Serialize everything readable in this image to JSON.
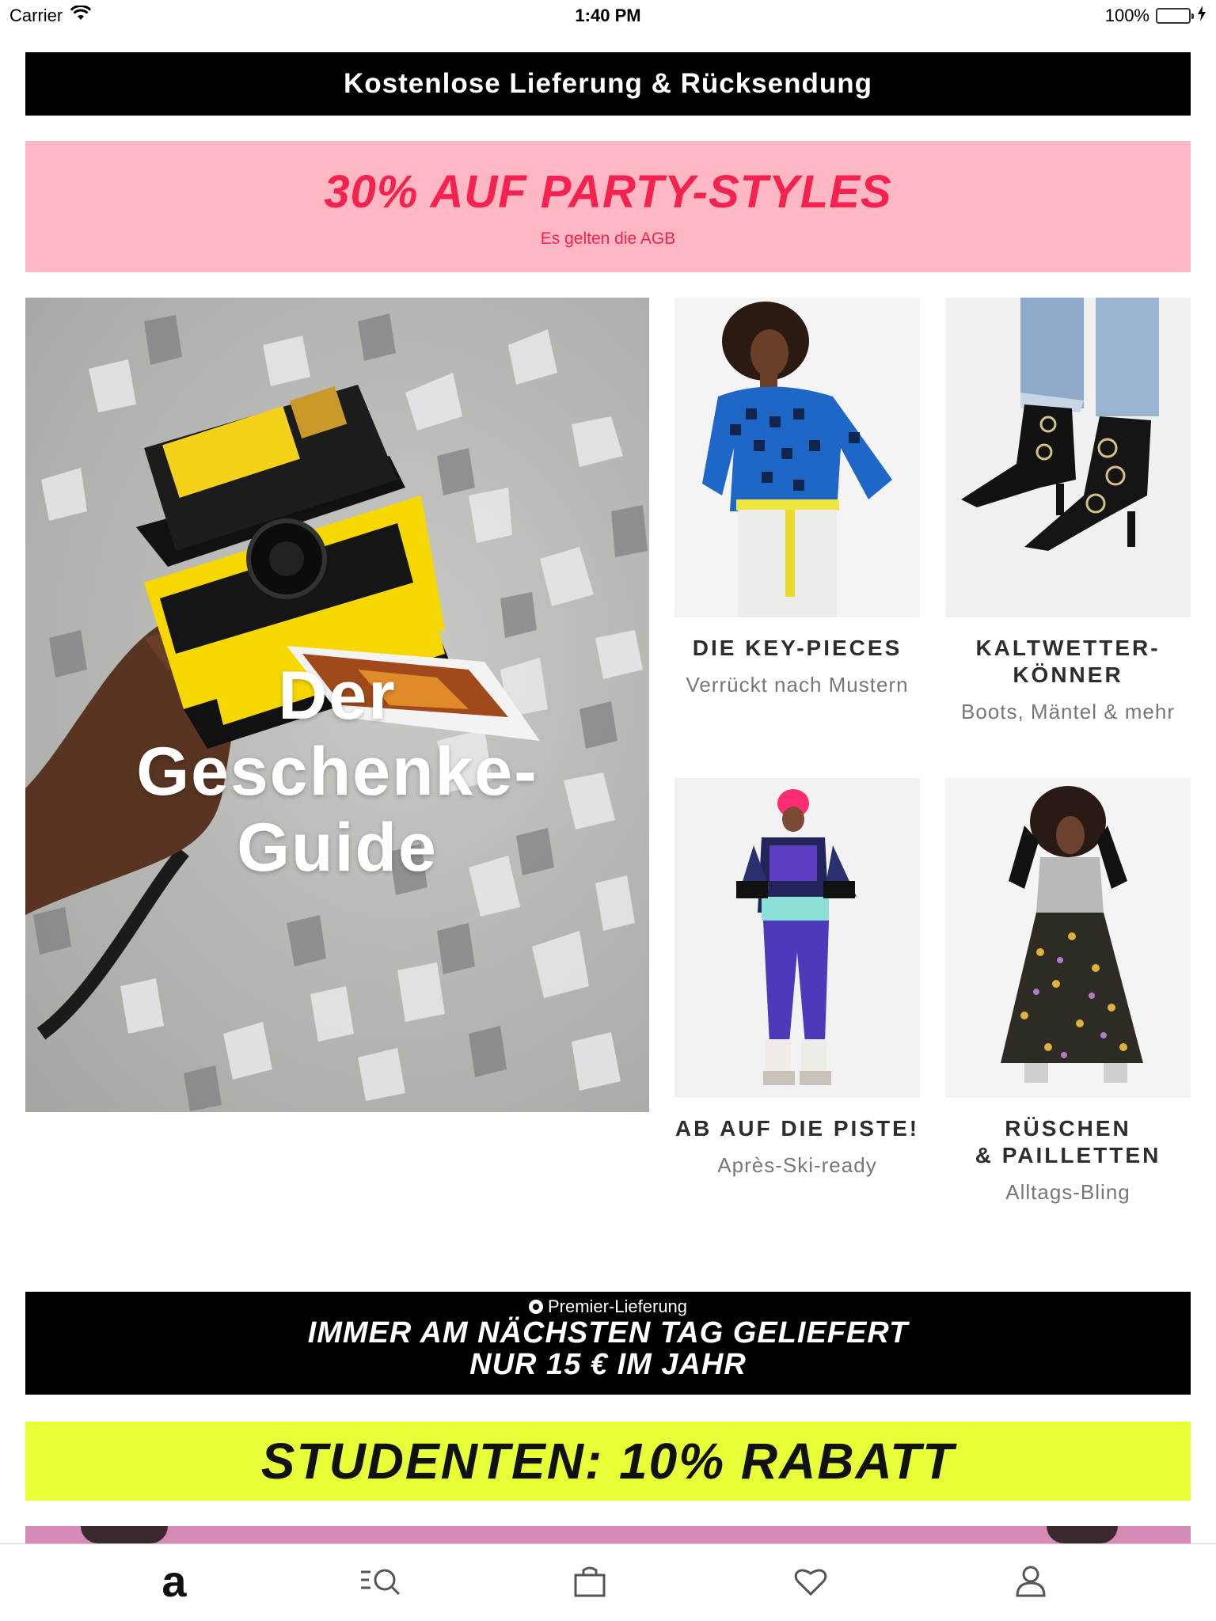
{
  "status_bar": {
    "carrier": "Carrier",
    "time": "1:40 PM",
    "battery": "100%",
    "battery_level": 1.0
  },
  "banners": {
    "delivery": "Kostenlose Lieferung & Rücksendung",
    "promo": {
      "headline": "30% AUF PARTY-STYLES",
      "sub": "Es gelten die AGB"
    },
    "premier": {
      "label": "Premier-Lieferung",
      "line1": "IMMER AM NÄCHSTEN TAG GELIEFERT",
      "line2": "NUR 15 € IM JAHR"
    },
    "student": "STUDENTEN: 10% RABATT"
  },
  "hero": {
    "title_line1": "Der",
    "title_line2": "Geschenke-",
    "title_line3": "Guide"
  },
  "tiles": [
    {
      "title_line1": "DIE KEY-PIECES",
      "title_line2": "",
      "subtitle": "Verrückt nach Mustern"
    },
    {
      "title_line1": "KALTWETTER-",
      "title_line2": "KÖNNER",
      "subtitle": "Boots, Mäntel & mehr"
    },
    {
      "title_line1": "AB AUF DIE PISTE!",
      "title_line2": "",
      "subtitle": "Après-Ski-ready"
    },
    {
      "title_line1": "RÜSCHEN",
      "title_line2": "& PAILLETTEN",
      "subtitle": "Alltags-Bling"
    }
  ],
  "tabbar": {
    "items": [
      {
        "name": "home",
        "icon": "asos-logo-icon",
        "glyph": "a"
      },
      {
        "name": "search",
        "icon": "search-icon"
      },
      {
        "name": "bag",
        "icon": "bag-icon"
      },
      {
        "name": "saved",
        "icon": "heart-icon"
      },
      {
        "name": "account",
        "icon": "user-icon"
      }
    ]
  },
  "colors": {
    "promo_pink": "#ffb8c3",
    "promo_red": "#f5224f",
    "student_yellow": "#e7ff37",
    "black": "#000000"
  }
}
